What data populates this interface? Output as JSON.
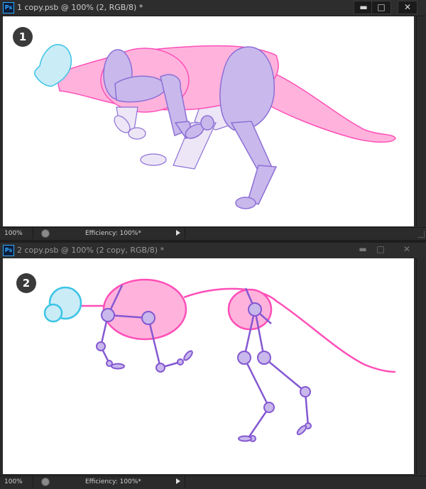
{
  "windows": [
    {
      "title": "1 copy.psb @ 100% (2, RGB/8) *",
      "app_icon": "Ps",
      "badge": "1",
      "status": {
        "zoom": "100%",
        "info": "Efficiency: 100%*"
      }
    },
    {
      "title": "2 copy.psb @ 100% (2 copy, RGB/8) *",
      "app_icon": "Ps",
      "badge": "2",
      "status": {
        "zoom": "100%",
        "info": "Efficiency: 100%*"
      }
    }
  ],
  "controls": {
    "minimize": "▬",
    "maximize": "□",
    "close": "✕"
  },
  "colors": {
    "body_pink": "#ffb3dc",
    "outline_pink": "#ff4fb8",
    "limb_lavender": "#c9b8ec",
    "limb_outline": "#8c6fd6",
    "limb_light": "#ede6f6",
    "head_blue": "#c9ecf7",
    "head_outline": "#3cc4e6",
    "bone_purple": "#8458d2"
  }
}
